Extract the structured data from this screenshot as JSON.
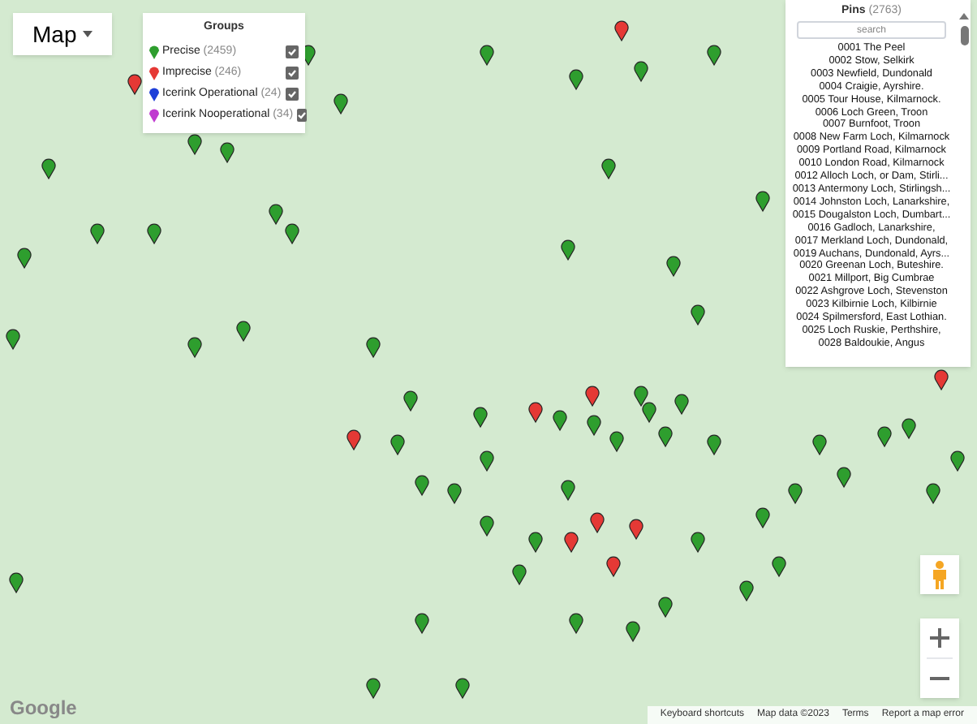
{
  "map_type_button": {
    "label": "Map"
  },
  "groups": {
    "title": "Groups",
    "items": [
      {
        "label": "Precise",
        "count": "(2459)",
        "checked": true,
        "color": "#2e9e2e"
      },
      {
        "label": "Imprecise",
        "count": "(246)",
        "checked": true,
        "color": "#e53935"
      },
      {
        "label": "Icerink Operational",
        "count": "(24)",
        "checked": true,
        "color": "#1e3fd8"
      },
      {
        "label": "Icerink Nooperational",
        "count": "(34)",
        "checked": true,
        "color": "#c03ad0"
      }
    ]
  },
  "pins_panel": {
    "title": "Pins",
    "count": "(2763)",
    "search": {
      "placeholder": "search"
    },
    "items": [
      "0001 The Peel",
      "0002 Stow, Selkirk",
      "0003 Newfield, Dundonald",
      "0004 Craigie, Ayrshire.",
      "0005 Tour House, Kilmarnock.",
      "0006 Loch Green, Troon",
      "0007 Burnfoot, Troon",
      "0008 New Farm Loch, Kilmarnock",
      "0009 Portland Road, Kilmarnock",
      "0010 London Road, Kilmarnock",
      "0012 Alloch Loch, or Dam, Stirli...",
      "0013 Antermony Loch, Stirlingsh...",
      "0014 Johnston Loch, Lanarkshire,",
      "0015 Dougalston Loch, Dumbart...",
      "0016 Gadloch, Lanarkshire,",
      "0017 Merkland Loch, Dundonald,",
      "0019 Auchans, Dundonald, Ayrs...",
      "0020 Greenan Loch, Buteshire.",
      "0021 Millport, Big Cumbrae",
      "0022 Ashgrove Loch, Stevenston",
      "0023 Kilbirnie Loch, Kilbirnie",
      "0024 Spilmersford, East Lothian.",
      "0025 Loch Ruskie, Perthshire,",
      "0028 Baldoukie, Angus"
    ]
  },
  "footer": {
    "logo": "Google",
    "links": [
      "Keyboard shortcuts",
      "Map data ©2023",
      "Terms",
      "Report a map error"
    ]
  }
}
